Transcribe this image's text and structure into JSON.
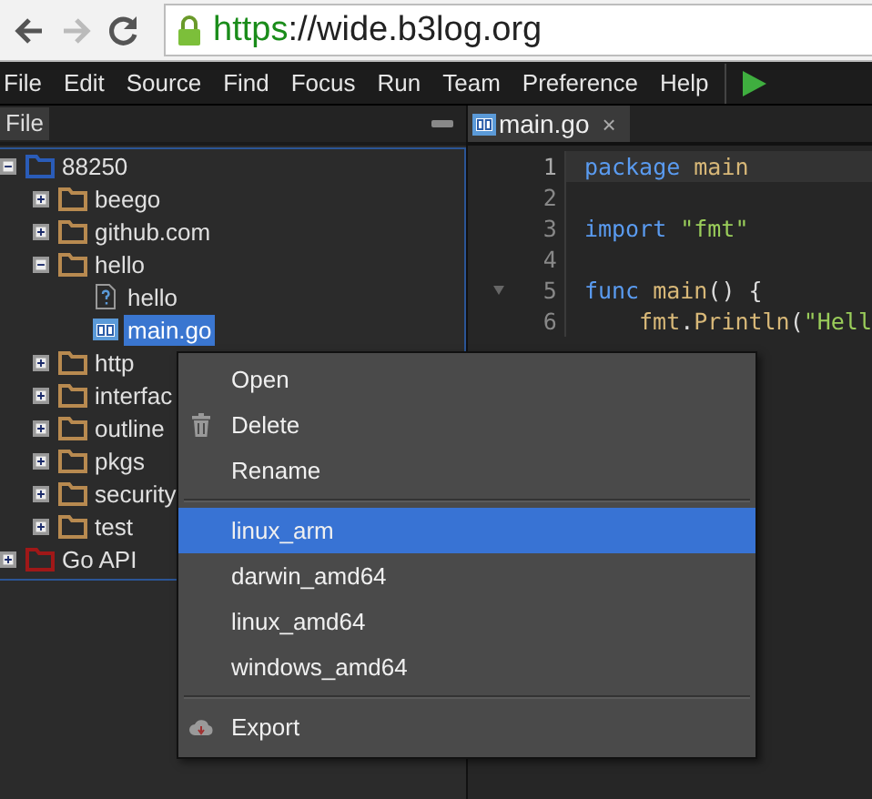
{
  "browser": {
    "url_scheme": "https",
    "url_rest": "://wide.b3log.org"
  },
  "menu_bar": [
    "File",
    "Edit",
    "Source",
    "Find",
    "Focus",
    "Run",
    "Team",
    "Preference",
    "Help"
  ],
  "side_panel": {
    "title": "File"
  },
  "tree": [
    {
      "label": "88250",
      "kind": "folder",
      "color": "#2a5cb8",
      "expanded": true,
      "selected": false,
      "children": [
        {
          "label": "beego",
          "kind": "folder",
          "expanded": false,
          "selected": false
        },
        {
          "label": "github.com",
          "kind": "folder",
          "expanded": false,
          "selected": false
        },
        {
          "label": "hello",
          "kind": "folder",
          "expanded": true,
          "selected": false,
          "children": [
            {
              "label": "hello",
              "kind": "unknown-file",
              "selected": false
            },
            {
              "label": "main.go",
              "kind": "go-file",
              "selected": true
            }
          ]
        },
        {
          "label": "http",
          "kind": "folder",
          "expanded": false,
          "selected": false
        },
        {
          "label": "interfac",
          "kind": "folder",
          "expanded": false,
          "selected": false
        },
        {
          "label": "outline",
          "kind": "folder",
          "expanded": false,
          "selected": false
        },
        {
          "label": "pkgs",
          "kind": "folder",
          "expanded": false,
          "selected": false
        },
        {
          "label": "security",
          "kind": "folder",
          "expanded": false,
          "selected": false
        },
        {
          "label": "test",
          "kind": "folder",
          "expanded": false,
          "selected": false
        }
      ]
    },
    {
      "label": "Go API",
      "kind": "folder",
      "color": "#a01818",
      "expanded": false,
      "selected": false
    }
  ],
  "editor_tabs": [
    {
      "label": "main.go",
      "close": "×",
      "selected": true
    }
  ],
  "code_lines": [
    {
      "number": "1",
      "current": true,
      "tokens": [
        {
          "kind": "keyword",
          "text": "package"
        },
        {
          "kind": "ident",
          "text": "main",
          "space": true
        }
      ]
    },
    {
      "number": "2",
      "current": false
    },
    {
      "number": "3",
      "current": false,
      "tokens": [
        {
          "kind": "keyword",
          "text": "import"
        },
        {
          "kind": "string",
          "text": "\"fmt\"",
          "space": true
        }
      ]
    },
    {
      "number": "4",
      "current": false
    },
    {
      "number": "5",
      "current": false,
      "fold": true,
      "tokens": [
        {
          "kind": "keyword",
          "text": "func"
        },
        {
          "kind": "ident",
          "text": "main",
          "space": true
        },
        {
          "kind": "plain",
          "text": "()"
        },
        {
          "kind": "plain",
          "text": "{",
          "space": true
        }
      ]
    },
    {
      "number": "6",
      "current": false,
      "indented": true,
      "tokens": [
        {
          "kind": "ident",
          "text": "fmt"
        },
        {
          "kind": "plain",
          "text": "."
        },
        {
          "kind": "ident",
          "text": "Println"
        },
        {
          "kind": "plain",
          "text": "("
        },
        {
          "kind": "string",
          "text": "\"Hell"
        }
      ]
    }
  ],
  "context_menu": [
    {
      "kind": "item",
      "label": "Open",
      "selected": false
    },
    {
      "kind": "item",
      "label": "Delete",
      "selected": false
    },
    {
      "kind": "item",
      "label": "Rename",
      "selected": false
    },
    {
      "kind": "separator"
    },
    {
      "kind": "item",
      "label": "linux_arm",
      "selected": true
    },
    {
      "kind": "item",
      "label": "darwin_amd64",
      "selected": false
    },
    {
      "kind": "item",
      "label": "linux_amd64",
      "selected": false
    },
    {
      "kind": "item",
      "label": "windows_amd64",
      "selected": false
    },
    {
      "kind": "separator"
    },
    {
      "kind": "item",
      "label": "Export",
      "selected": false
    }
  ]
}
